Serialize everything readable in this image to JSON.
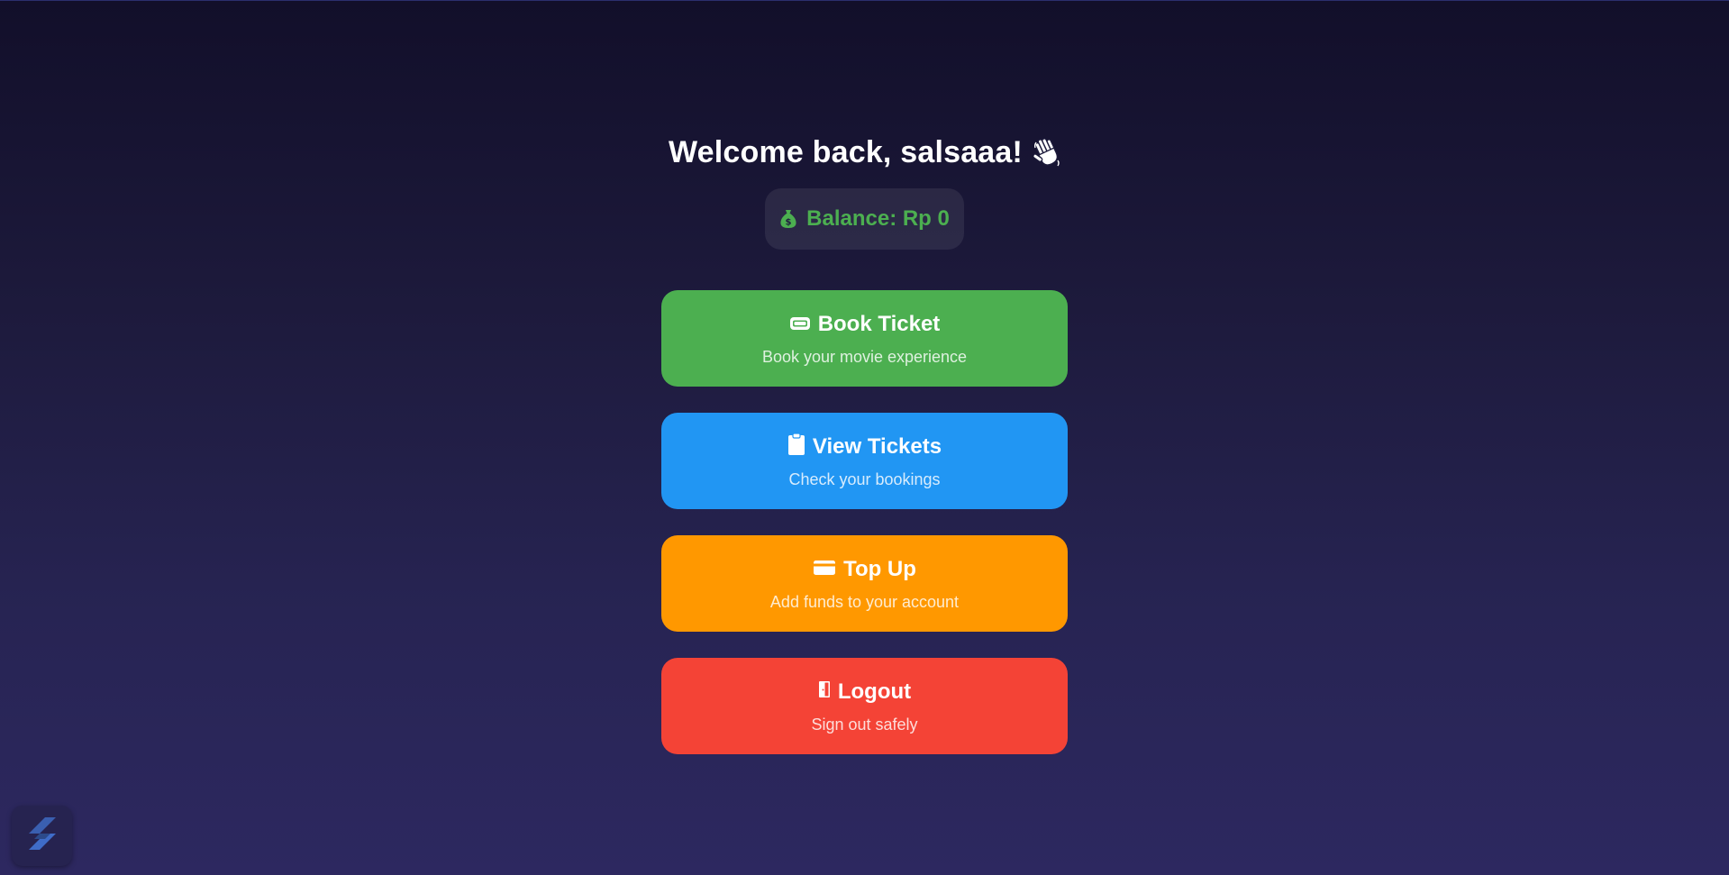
{
  "welcome": {
    "text": "Welcome back, salsaaa!",
    "icon": "waving-hand-icon"
  },
  "balance": {
    "text": "Balance: Rp 0",
    "icon": "money-bag-icon",
    "color": "#4caf50"
  },
  "actions": [
    {
      "title": "Book Ticket",
      "subtitle": "Book your movie experience",
      "icon": "ticket-icon",
      "color": "#4caf50"
    },
    {
      "title": "View Tickets",
      "subtitle": "Check your bookings",
      "icon": "clipboard-icon",
      "color": "#2196f3"
    },
    {
      "title": "Top Up",
      "subtitle": "Add funds to your account",
      "icon": "credit-card-icon",
      "color": "#ff9800"
    },
    {
      "title": "Logout",
      "subtitle": "Sign out safely",
      "icon": "door-icon",
      "color": "#f44336"
    }
  ],
  "widget": {
    "icon": "app-logo-icon"
  }
}
